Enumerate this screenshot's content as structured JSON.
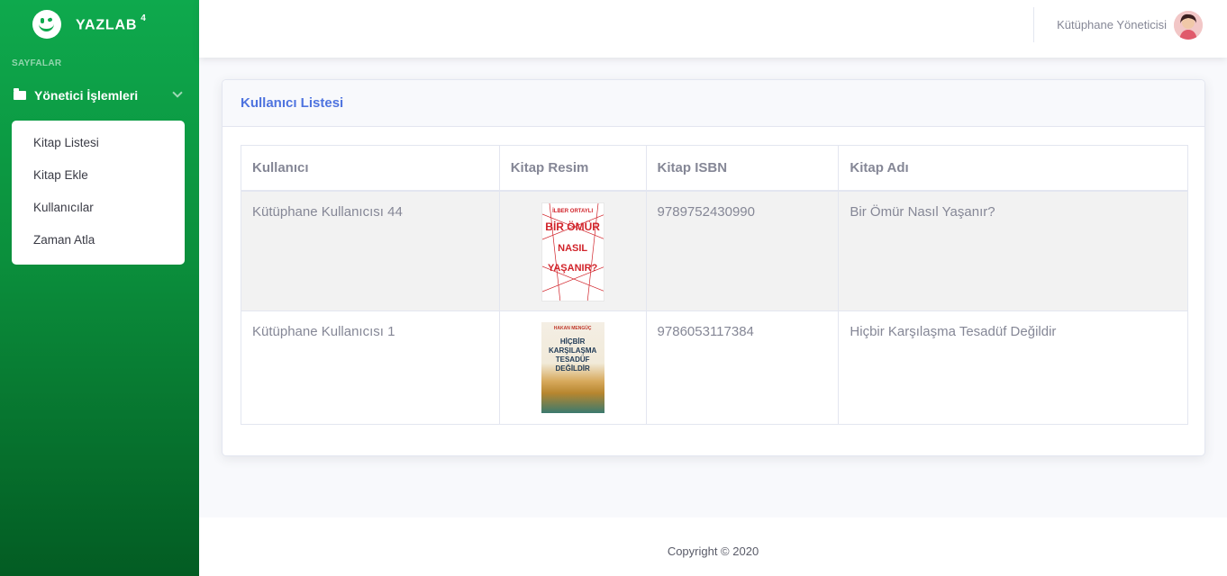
{
  "brand": {
    "name": "YAZLAB",
    "superscript": "4"
  },
  "sidebar": {
    "heading": "SAYFALAR",
    "section": {
      "label": "Yönetici İşlemleri",
      "icon": "folder-icon",
      "expanded": true
    },
    "items": [
      {
        "label": "Kitap Listesi"
      },
      {
        "label": "Kitap Ekle"
      },
      {
        "label": "Kullanıcılar"
      },
      {
        "label": "Zaman Atla"
      }
    ]
  },
  "topbar": {
    "user_name": "Kütüphane Yöneticisi"
  },
  "card": {
    "title": "Kullanıcı Listesi"
  },
  "table": {
    "headers": [
      "Kullanıcı",
      "Kitap Resim",
      "Kitap ISBN",
      "Kitap Adı"
    ],
    "rows": [
      {
        "user": "Kütüphane Kullanıcısı 44",
        "isbn": "9789752430990",
        "book": "Bir Ömür Nasıl Yaşanır?",
        "cover": {
          "author": "İLBER ORTAYLI",
          "title_lines": [
            "BİR ÖMÜR",
            "NASIL",
            "YAŞANIR?"
          ]
        }
      },
      {
        "user": "Kütüphane Kullanıcısı 1",
        "isbn": "9786053117384",
        "book": "Hiçbir Karşılaşma Tesadüf Değildir",
        "cover": {
          "author": "HAKAN MENGÜÇ",
          "title_lines": [
            "HİÇBİR",
            "KARŞILAŞMA",
            "TESADÜF",
            "DEĞİLDİR"
          ]
        }
      }
    ]
  },
  "footer": {
    "copyright": "Copyright © 2020"
  },
  "colors": {
    "sidebar_top": "#0ea94d",
    "sidebar_bottom": "#035c23",
    "accent": "#4e73df"
  }
}
